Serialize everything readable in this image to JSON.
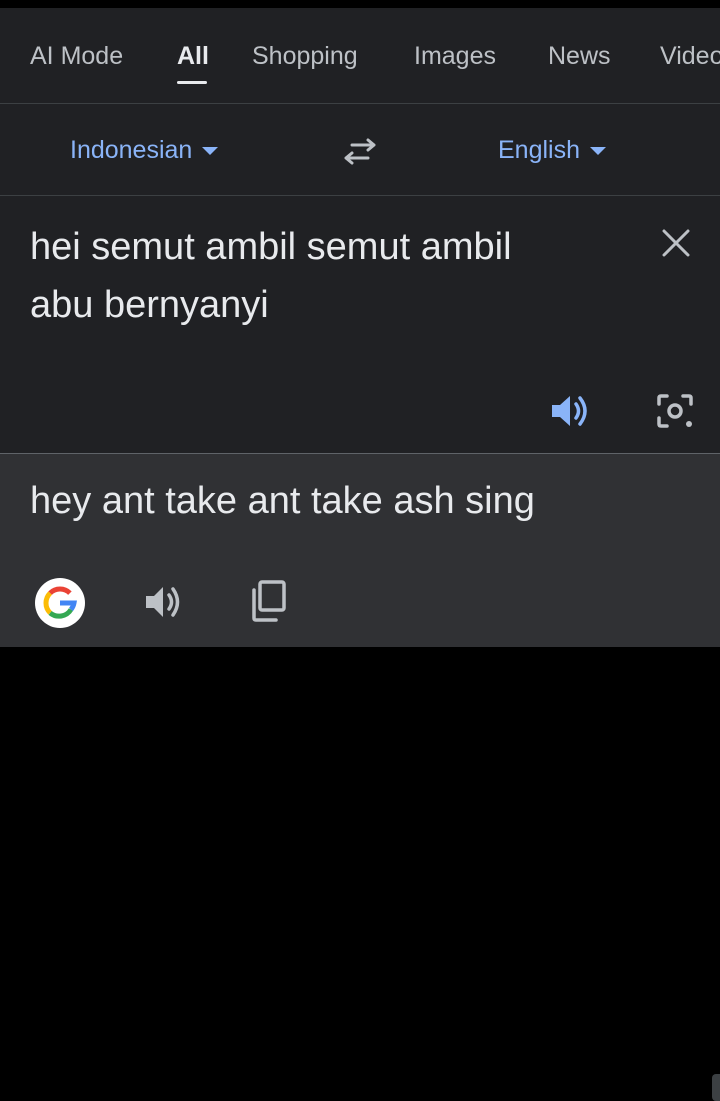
{
  "tabs": [
    {
      "label": "AI Mode"
    },
    {
      "label": "All"
    },
    {
      "label": "Shopping"
    },
    {
      "label": "Images"
    },
    {
      "label": "News"
    },
    {
      "label": "Videos"
    }
  ],
  "active_tab": "All",
  "translate": {
    "source_language": "Indonesian",
    "target_language": "English",
    "source_text": "hei semut ambil semut ambil abu bernyanyi",
    "translated_text": "hey ant take ant take ash sing"
  },
  "icons": {
    "swap": "swap-languages-icon",
    "clear": "close-icon",
    "listen_source": "speaker-icon",
    "camera": "camera-icon",
    "google": "google-logo-icon",
    "listen_result": "speaker-icon",
    "copy": "copy-icon"
  },
  "colors": {
    "background": "#202124",
    "result_background": "#303134",
    "accent_link": "#8ab4f8",
    "text": "#e8eaed",
    "muted_text": "#bdc1c6"
  }
}
